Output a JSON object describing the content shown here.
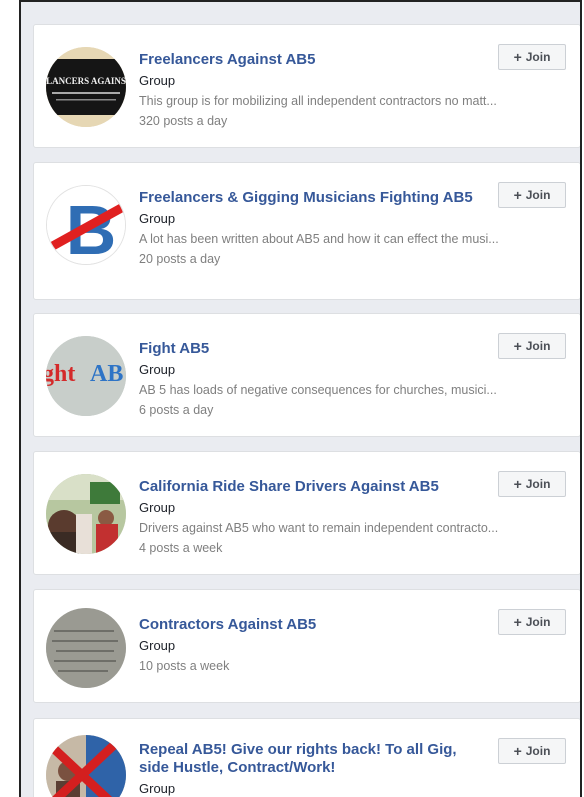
{
  "join_label": "Join",
  "groups": [
    {
      "name": "Freelancers Against AB5",
      "kind": "Group",
      "description": "This group is for mobilizing all independent contractors no matt...",
      "activity": "320 posts a day",
      "avatar_text": "LANCERS AGAINS"
    },
    {
      "name": "Freelancers & Gigging Musicians Fighting AB5",
      "kind": "Group",
      "description": "A lot has been written about AB5 and how it can effect the musi...",
      "activity": "20 posts a day",
      "avatar_text": "B"
    },
    {
      "name": "Fight AB5",
      "kind": "Group",
      "description": "AB 5 has loads of negative consequences for churches, musici...",
      "activity": "6 posts a day",
      "avatar_text": "ght AB"
    },
    {
      "name": "California Ride Share Drivers Against AB5",
      "kind": "Group",
      "description": "Drivers against AB5 who want to remain independent contracto...",
      "activity": "4 posts a week"
    },
    {
      "name": "Contractors Against AB5",
      "kind": "Group",
      "activity": "10 posts a week"
    },
    {
      "name": "Repeal AB5! Give our rights back! To all Gig, side Hustle, Contract/Work!",
      "kind": "Group"
    }
  ],
  "colors": {
    "link_blue": "#365899",
    "muted_text": "#7f7f7f",
    "page_bg": "#eaecf1",
    "card_bg": "#ffffff"
  }
}
